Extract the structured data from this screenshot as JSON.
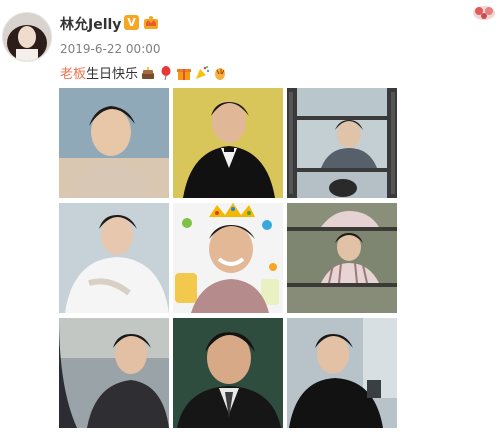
{
  "user": {
    "name": "林允Jelly",
    "verified_badge": "V",
    "avatar": "avatar-photo",
    "rank_icon": "crown-icon"
  },
  "post": {
    "timestamp": "2019-6-22 00:00",
    "mention": "老板",
    "text": "生日快乐",
    "emojis": [
      "cake-emoji",
      "balloon-emoji",
      "gift-emoji",
      "party-popper-emoji",
      "clap-emoji"
    ]
  },
  "photos": [
    {
      "name": "photo-1",
      "description": "smiling man in beige jacket"
    },
    {
      "name": "photo-2",
      "description": "man in black tuxedo"
    },
    {
      "name": "photo-3",
      "description": "film strip collage"
    },
    {
      "name": "photo-4",
      "description": "man in white shirt outdoors"
    },
    {
      "name": "photo-5",
      "description": "birthday edited photo with crown"
    },
    {
      "name": "photo-6",
      "description": "film strip collage striped shirt"
    },
    {
      "name": "photo-7",
      "description": "man in black jacket by fence"
    },
    {
      "name": "photo-8",
      "description": "man in suit close-up"
    },
    {
      "name": "photo-9",
      "description": "man in black jacket outdoors"
    }
  ],
  "colors": {
    "mention": "#eb7350",
    "username": "#333333",
    "timestamp": "#808080",
    "badge": "#f5a623"
  }
}
